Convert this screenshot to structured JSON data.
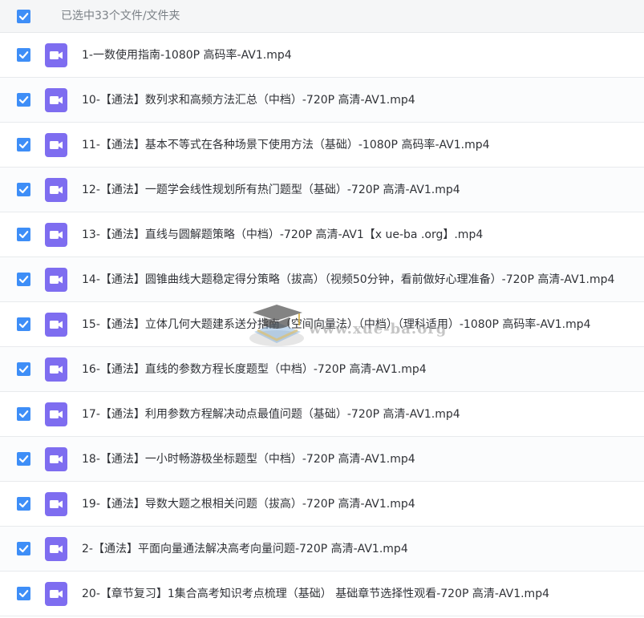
{
  "header": {
    "title": "已选中33个文件/文件夹",
    "checked": true
  },
  "files": [
    {
      "name": "1-一数使用指南-1080P 高码率-AV1.mp4",
      "checked": true
    },
    {
      "name": "10-【通法】数列求和高频方法汇总（中档）-720P 高清-AV1.mp4",
      "checked": true
    },
    {
      "name": "11-【通法】基本不等式在各种场景下使用方法（基础）-1080P 高码率-AV1.mp4",
      "checked": true
    },
    {
      "name": "12-【通法】一题学会线性规划所有热门题型（基础）-720P 高清-AV1.mp4",
      "checked": true
    },
    {
      "name": "13-【通法】直线与圆解题策略（中档）-720P 高清-AV1【x ue-ba .org】.mp4",
      "checked": true
    },
    {
      "name": "14-【通法】圆锥曲线大题稳定得分策略（拔高）（视频50分钟，看前做好心理准备）-720P 高清-AV1.mp4",
      "checked": true
    },
    {
      "name": "15-【通法】立体几何大题建系送分指南（空间向量法）（中档）（理科适用）-1080P 高码率-AV1.mp4",
      "checked": true
    },
    {
      "name": "16-【通法】直线的参数方程长度题型（中档）-720P 高清-AV1.mp4",
      "checked": true
    },
    {
      "name": "17-【通法】利用参数方程解决动点最值问题（基础）-720P 高清-AV1.mp4",
      "checked": true
    },
    {
      "name": "18-【通法】一小时畅游极坐标题型（中档）-720P 高清-AV1.mp4",
      "checked": true
    },
    {
      "name": "19-【通法】导数大题之根相关问题（拔高）-720P 高清-AV1.mp4",
      "checked": true
    },
    {
      "name": "2-【通法】平面向量通法解决高考向量问题-720P 高清-AV1.mp4",
      "checked": true
    },
    {
      "name": "20-【章节复习】1集合高考知识考点梳理（基础） 基础章节选择性观看-720P 高清-AV1.mp4",
      "checked": true
    }
  ],
  "watermark": {
    "text": "www.xue-ba.org"
  },
  "colors": {
    "checkbox": "#3e8ef7",
    "file_icon": "#7e6df0",
    "header_bg": "#f5f6f7",
    "text": "#303237"
  },
  "icons": {
    "checkbox": "checkmark-icon",
    "file": "video-file-icon"
  }
}
